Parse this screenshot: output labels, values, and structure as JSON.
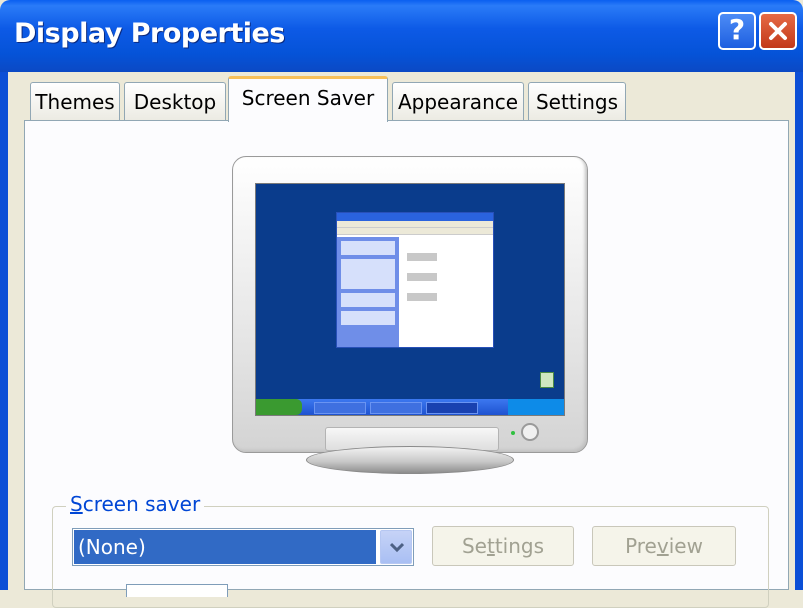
{
  "window": {
    "title": "Display Properties",
    "help_label": "?",
    "close_icon": "close-icon"
  },
  "tabs": [
    {
      "label": "Themes",
      "active": false
    },
    {
      "label": "Desktop",
      "active": false
    },
    {
      "label": "Screen Saver",
      "active": true
    },
    {
      "label": "Appearance",
      "active": false
    },
    {
      "label": "Settings",
      "active": false
    }
  ],
  "screensaver": {
    "group_label_first": "S",
    "group_label_rest": "creen saver",
    "selected": "(None)",
    "settings_button": {
      "pre": "Se",
      "u": "t",
      "post": "tings"
    },
    "preview_button": {
      "pre": "Pre",
      "u": "v",
      "post": "iew"
    }
  },
  "colors": {
    "titlebar": "#0553d8",
    "selection": "#316ac5",
    "active_tab_accent": "#f7c05a",
    "disabled_text": "#a1a192"
  }
}
